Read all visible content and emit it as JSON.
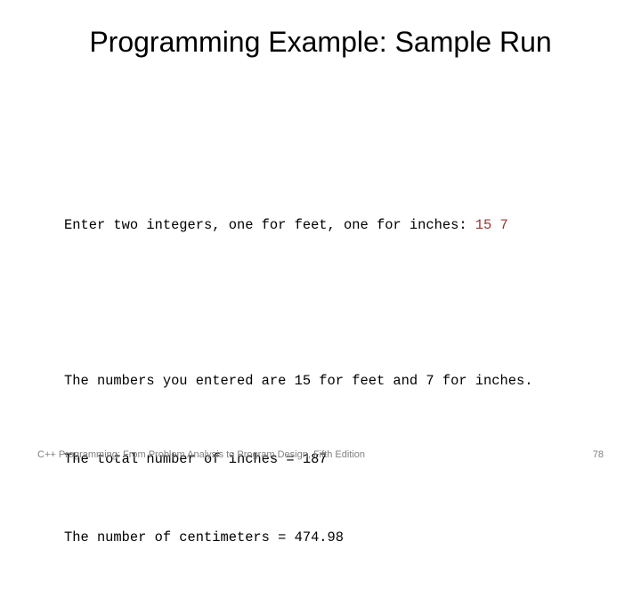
{
  "slide": {
    "title": "Programming Example: Sample Run",
    "console": {
      "line1_prompt": "Enter two integers, one for feet, one for inches: ",
      "line1_input": "15 7",
      "line1_input_color": "#993333",
      "line2": "The numbers you entered are 15 for feet and 7 for inches.",
      "line3": "The total number of inches = 187",
      "line4": "The number of centimeters = 474.98"
    },
    "footer": {
      "text": "C++ Programming: From Problem Analysis to Program Design, Fifth Edition",
      "page_number": "78",
      "color": "#808080"
    }
  }
}
